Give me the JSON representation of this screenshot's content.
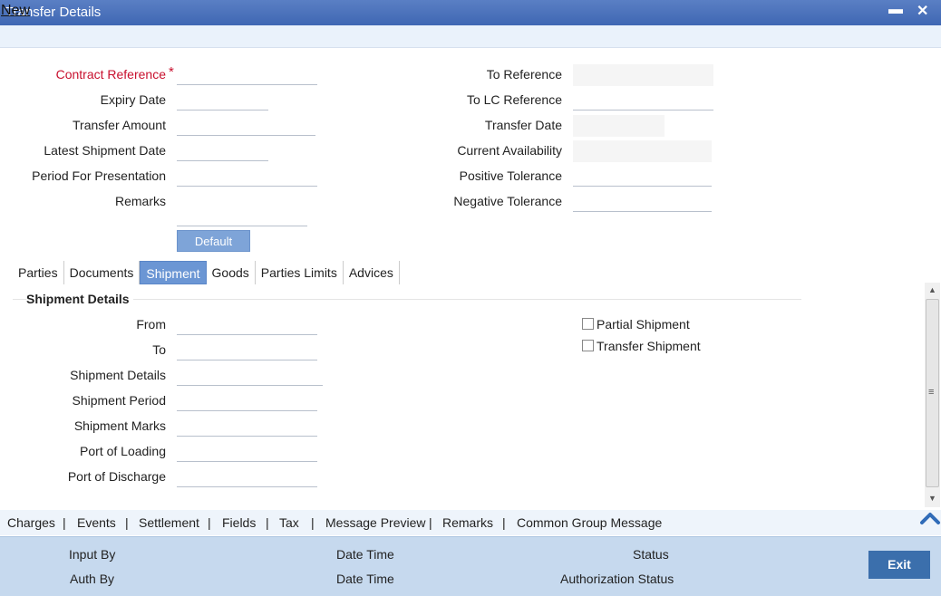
{
  "window": {
    "title": "Transfer Details",
    "minimize": "▬",
    "close": "✕"
  },
  "menu": {
    "new_label": "New"
  },
  "form_left": {
    "contract_reference": {
      "label": "Contract Reference",
      "required_mark": "*",
      "value": ""
    },
    "expiry_date": {
      "label": "Expiry Date",
      "value": ""
    },
    "transfer_amount": {
      "label": "Transfer Amount",
      "value": ""
    },
    "latest_shipment_date": {
      "label": "Latest Shipment Date",
      "value": ""
    },
    "period_for_presentation": {
      "label": "Period For Presentation",
      "value": ""
    },
    "remarks": {
      "label": "Remarks",
      "value": ""
    }
  },
  "form_right": {
    "to_reference": {
      "label": "To Reference",
      "value": ""
    },
    "to_lc_reference": {
      "label": "To LC Reference",
      "value": ""
    },
    "transfer_date": {
      "label": "Transfer Date",
      "value": ""
    },
    "current_availability": {
      "label": "Current Availability",
      "value": ""
    },
    "positive_tolerance": {
      "label": "Positive Tolerance",
      "value": ""
    },
    "negative_tolerance": {
      "label": "Negative Tolerance",
      "value": ""
    }
  },
  "default_button": "Default",
  "tabs": [
    {
      "label": "Parties"
    },
    {
      "label": "Documents"
    },
    {
      "label": "Shipment",
      "active": true
    },
    {
      "label": "Goods"
    },
    {
      "label": "Parties Limits"
    },
    {
      "label": "Advices"
    }
  ],
  "shipment": {
    "section_title": "Shipment Details",
    "from": {
      "label": "From",
      "value": ""
    },
    "to": {
      "label": "To",
      "value": ""
    },
    "details": {
      "label": "Shipment Details",
      "value": ""
    },
    "period": {
      "label": "Shipment Period",
      "value": ""
    },
    "marks": {
      "label": "Shipment Marks",
      "value": ""
    },
    "port_loading": {
      "label": "Port of Loading",
      "value": ""
    },
    "port_discharge": {
      "label": "Port of Discharge",
      "value": ""
    },
    "partial_shipment": {
      "label": "Partial Shipment",
      "checked": false
    },
    "transfer_shipment": {
      "label": "Transfer Shipment",
      "checked": false
    }
  },
  "bottom_nav": {
    "items": [
      "Charges",
      "Events",
      "Settlement",
      "Fields",
      "Tax",
      "Message Preview",
      "Remarks",
      "Common Group Message"
    ],
    "separator": "|"
  },
  "footer": {
    "input_by": "Input By",
    "date_time_1": "Date Time",
    "status": "Status",
    "auth_by": "Auth By",
    "date_time_2": "Date Time",
    "authorization_status": "Authorization Status",
    "exit_label": "Exit"
  },
  "icons": {
    "scroll_up": "▲",
    "scroll_down": "▼",
    "scroll_grip": "≡",
    "collapse": "chevron-up-icon"
  },
  "colors": {
    "titlebar": "#4a72bb",
    "required": "#c8102e",
    "active_tab": "#6b96d4",
    "footer_bg": "#c6d9ee",
    "exit_button": "#3b6fac"
  }
}
